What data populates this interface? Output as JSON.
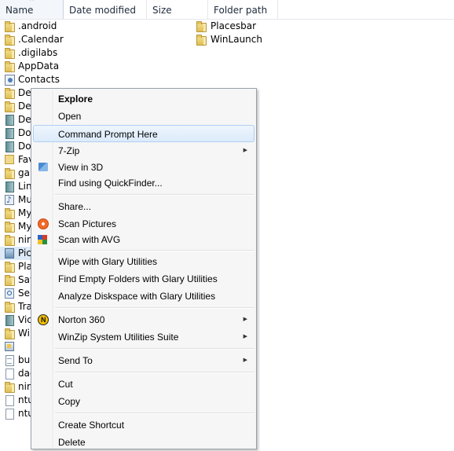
{
  "columns": {
    "name": "Name",
    "date_modified": "Date modified",
    "size": "Size",
    "folder_path": "Folder path"
  },
  "files": [
    {
      "label": ".android",
      "icon": "folder-icon"
    },
    {
      "label": ".Calendar",
      "icon": "folder-icon"
    },
    {
      "label": ".digilabs",
      "icon": "folder-icon"
    },
    {
      "label": "AppData",
      "icon": "folder-icon"
    },
    {
      "label": "Contacts",
      "icon": "contacts-icon"
    },
    {
      "label": "De",
      "icon": "folder-icon"
    },
    {
      "label": "De",
      "icon": "folder-icon"
    },
    {
      "label": "De",
      "icon": "library-icon"
    },
    {
      "label": "Do",
      "icon": "library-icon"
    },
    {
      "label": "Do",
      "icon": "library-icon"
    },
    {
      "label": "Fav",
      "icon": "favorites-icon"
    },
    {
      "label": "gar",
      "icon": "folder-icon"
    },
    {
      "label": "Lin",
      "icon": "library-icon"
    },
    {
      "label": "Mu",
      "icon": "music-icon"
    },
    {
      "label": "My",
      "icon": "folder-icon"
    },
    {
      "label": "My",
      "icon": "folder-icon"
    },
    {
      "label": "nir",
      "icon": "folder-icon"
    },
    {
      "label": "Pic",
      "icon": "pictures-icon"
    },
    {
      "label": "Pla",
      "icon": "folder-icon"
    },
    {
      "label": "Sav",
      "icon": "folder-icon"
    },
    {
      "label": "Sea",
      "icon": "search-icon"
    },
    {
      "label": "Tra",
      "icon": "folder-icon"
    },
    {
      "label": "Vic",
      "icon": "library-icon"
    },
    {
      "label": "Wi",
      "icon": "folder-icon"
    },
    {
      "label": "",
      "icon": "application-icon"
    },
    {
      "label": "bu",
      "icon": "notepad-icon"
    },
    {
      "label": "dac",
      "icon": "file-icon"
    },
    {
      "label": "nir",
      "icon": "folder-icon"
    },
    {
      "label": "ntu",
      "icon": "file-icon"
    },
    {
      "label": "ntu",
      "icon": "file-icon"
    }
  ],
  "path_items": [
    {
      "label": "Placesbar",
      "icon": "folder-icon"
    },
    {
      "label": "WinLaunch",
      "icon": "folder-icon"
    }
  ],
  "context_menu": {
    "explore": "Explore",
    "open": "Open",
    "command_prompt_here": "Command Prompt Here",
    "seven_zip": "7-Zip",
    "view_in_3d": "View in 3D",
    "find_using_quickfinder": "Find using QuickFinder...",
    "share": "Share...",
    "scan_pictures": "Scan Pictures",
    "scan_with_avg": "Scan with AVG",
    "wipe_glary": "Wipe with Glary Utilities",
    "find_empty_folders": "Find Empty Folders with Glary Utilities",
    "analyze_diskspace": "Analyze Diskspace with Glary Utilities",
    "norton_360": "Norton 360",
    "winzip_suite": "WinZip System Utilities Suite",
    "send_to": "Send To",
    "cut": "Cut",
    "copy": "Copy",
    "create_shortcut": "Create Shortcut",
    "delete_partial": "Delete"
  }
}
